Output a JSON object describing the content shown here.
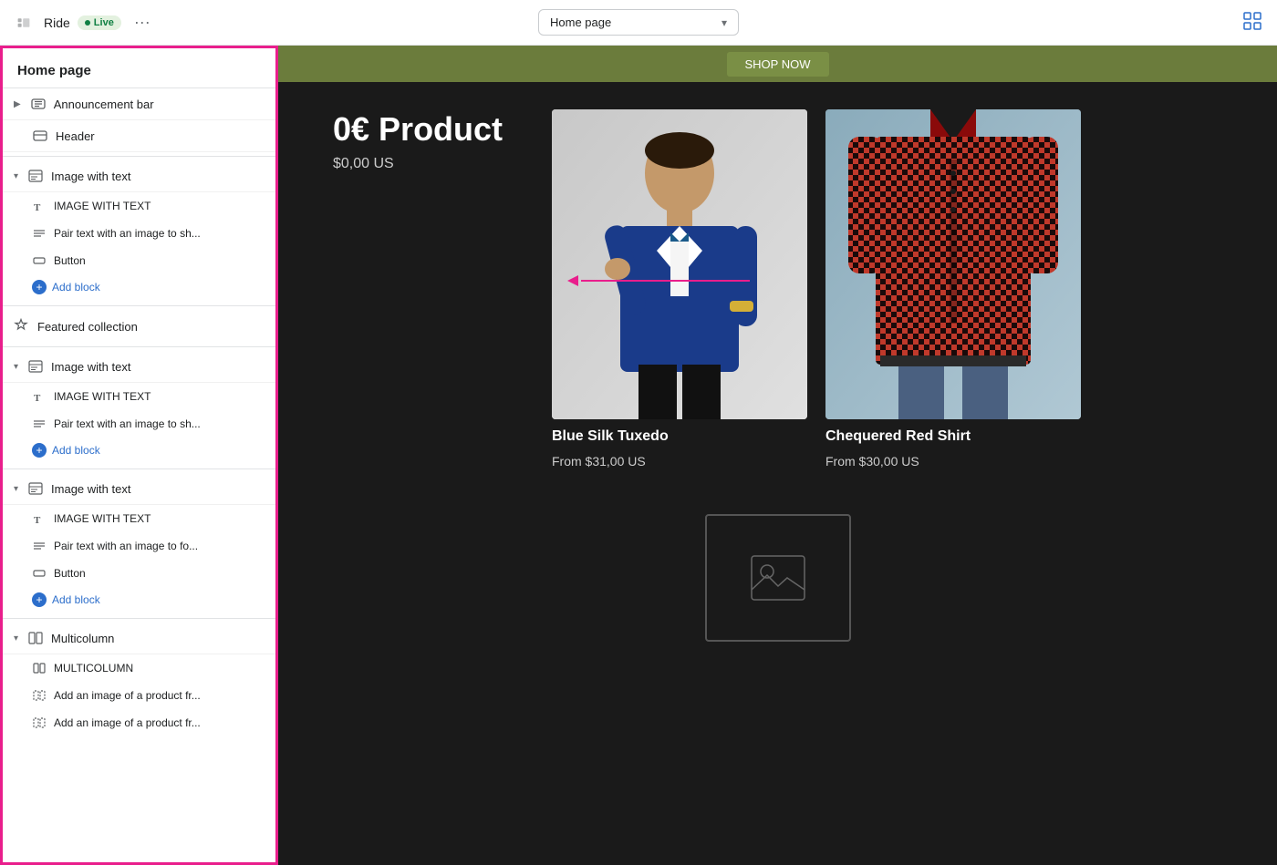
{
  "topbar": {
    "app_name": "Ride",
    "live_label": "Live",
    "more_button_label": "···",
    "page_selector_label": "Home page",
    "back_icon": "back-icon",
    "grid_icon": "grid-icon"
  },
  "sidebar": {
    "title": "Home page",
    "sections": [
      {
        "id": "announcement-bar",
        "label": "Announcement bar",
        "icon": "announcement-icon",
        "expanded": false,
        "children": []
      },
      {
        "id": "header",
        "label": "Header",
        "icon": "header-icon",
        "expanded": false,
        "children": []
      },
      {
        "id": "image-with-text-1",
        "label": "Image with text",
        "icon": "section-icon",
        "expanded": true,
        "children": [
          {
            "id": "iwt1-title",
            "label": "IMAGE WITH TEXT",
            "icon": "text-icon"
          },
          {
            "id": "iwt1-pair",
            "label": "Pair text with an image to sh...",
            "icon": "list-icon"
          },
          {
            "id": "iwt1-button",
            "label": "Button",
            "icon": "button-icon"
          },
          {
            "id": "iwt1-add",
            "label": "Add block",
            "type": "add"
          }
        ]
      },
      {
        "id": "featured-collection",
        "label": "Featured collection",
        "icon": "featured-icon",
        "expanded": false,
        "children": []
      },
      {
        "id": "image-with-text-2",
        "label": "Image with text",
        "icon": "section-icon",
        "expanded": true,
        "children": [
          {
            "id": "iwt2-title",
            "label": "IMAGE WITH TEXT",
            "icon": "text-icon"
          },
          {
            "id": "iwt2-pair",
            "label": "Pair text with an image to sh...",
            "icon": "list-icon"
          },
          {
            "id": "iwt2-add",
            "label": "Add block",
            "type": "add"
          }
        ]
      },
      {
        "id": "image-with-text-3",
        "label": "Image with text",
        "icon": "section-icon",
        "expanded": true,
        "children": [
          {
            "id": "iwt3-title",
            "label": "IMAGE WITH TEXT",
            "icon": "text-icon"
          },
          {
            "id": "iwt3-pair",
            "label": "Pair text with an image to fo...",
            "icon": "list-icon"
          },
          {
            "id": "iwt3-button",
            "label": "Button",
            "icon": "button-icon"
          },
          {
            "id": "iwt3-add",
            "label": "Add block",
            "type": "add"
          }
        ]
      },
      {
        "id": "multicolumn",
        "label": "Multicolumn",
        "icon": "multicolumn-icon",
        "expanded": true,
        "children": [
          {
            "id": "mc-title",
            "label": "MULTICOLUMN",
            "icon": "multicolumn-item-icon"
          },
          {
            "id": "mc-add1",
            "label": "Add an image of a product fr...",
            "icon": "multicolumn-item-icon"
          },
          {
            "id": "mc-add2",
            "label": "Add an image of a product fr...",
            "icon": "multicolumn-item-icon"
          }
        ]
      }
    ]
  },
  "preview": {
    "cta_button_label": "SHOP NOW",
    "product_featured": {
      "title": "0€ Product",
      "price": "$0,00 US"
    },
    "products": [
      {
        "id": "blue-tuxedo",
        "name": "Blue Silk Tuxedo",
        "price": "From $31,00 US"
      },
      {
        "id": "red-shirt",
        "name": "Chequered Red Shirt",
        "price": "From $30,00 US"
      }
    ]
  }
}
